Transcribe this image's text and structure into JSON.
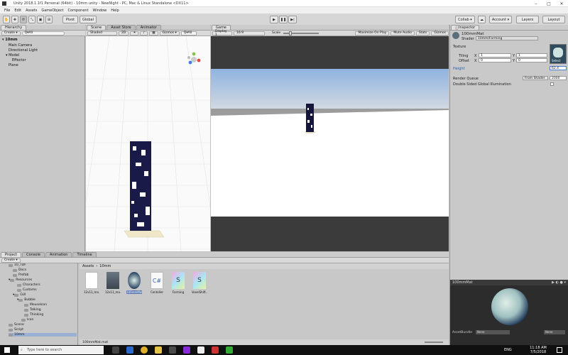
{
  "window": {
    "title": "Unity 2018.1.1f1 Personal (64bit) - 10mm.unity - NewNight - PC, Mac & Linux Standalone <DX11>"
  },
  "menu": [
    "File",
    "Edit",
    "Assets",
    "GameObject",
    "Component",
    "Window",
    "Help"
  ],
  "toolbar": {
    "pivot_label": "Pivot",
    "global_label": "Global",
    "play_icon": "play-icon",
    "collab_label": "Collab ▾",
    "account_label": "Account ▾",
    "layers_label": "Layers",
    "layout_label": "Layout"
  },
  "hierarchy": {
    "tab": "Hierarchy",
    "create_label": "Create ▾",
    "search_placeholder": "Q▾All",
    "scene_name": "10mm",
    "items": [
      "Main Camera",
      "Directional Light",
      "Model",
      "Effector",
      "Plane"
    ]
  },
  "scene": {
    "tabs": [
      "Scene",
      "Asset Store",
      "Animator"
    ],
    "shading": "Shaded",
    "mode": "2D",
    "gizmos_label": "Gizmos ▾",
    "search_placeholder": "Q▾All"
  },
  "game": {
    "tab": "Game",
    "display": "Display 1",
    "aspect": "16:9",
    "scale_label": "Scale",
    "buttons": [
      "Maximize On Play",
      "Mute Audio",
      "Stats",
      "Gizmos"
    ]
  },
  "inspector": {
    "tab": "Inspector",
    "material_name": "100mmMat",
    "shader_label": "Shader",
    "shader_value": "10mm/Forming",
    "texture_label": "Texture",
    "tiling_label": "Tiling",
    "offset_label": "Offset",
    "tiling_x": "1",
    "tiling_y": "1",
    "offset_x": "0",
    "offset_y": "0",
    "select_label": "Select",
    "height_label": "Height",
    "height_value": "62.4",
    "render_queue_label": "Render Queue",
    "render_queue_mode": "From Shader",
    "render_queue_value": "2000",
    "double_sided_label": "Double Sided Global Illumination",
    "preview_title": "100mmMat",
    "asset_bundle_label": "AssetBundle",
    "asset_bundle_value": "None",
    "asset_bundle_variant": "None"
  },
  "project": {
    "tabs": [
      "Project",
      "Console",
      "Animation",
      "Timeline"
    ],
    "create_label": "Create ▾",
    "breadcrumb": [
      "Assets",
      "10mm"
    ],
    "tree": [
      "10_TDF",
      "Docs",
      "Prefab",
      "Resources",
      "Characters",
      "Customs",
      "GUI",
      "Bubble",
      "MouseIcon",
      "Talking",
      "Thinking",
      "Icon",
      "Scene",
      "Script",
      "10mm"
    ],
    "assets": [
      {
        "label": "12x13_ma...",
        "kind": "doc"
      },
      {
        "label": "12x13_ma...",
        "kind": "mesh"
      },
      {
        "label": "100mmMat",
        "kind": "material"
      },
      {
        "label": "Contoller",
        "kind": "cs"
      },
      {
        "label": "Forming",
        "kind": "shader"
      },
      {
        "label": "VoxelShift...",
        "kind": "shader"
      }
    ],
    "footer_file": "100mmMat.mat"
  },
  "taskbar": {
    "search_placeholder": "Type here to search",
    "time": "11:18 AM",
    "date": "7/5/2018",
    "lang": "ENG"
  }
}
